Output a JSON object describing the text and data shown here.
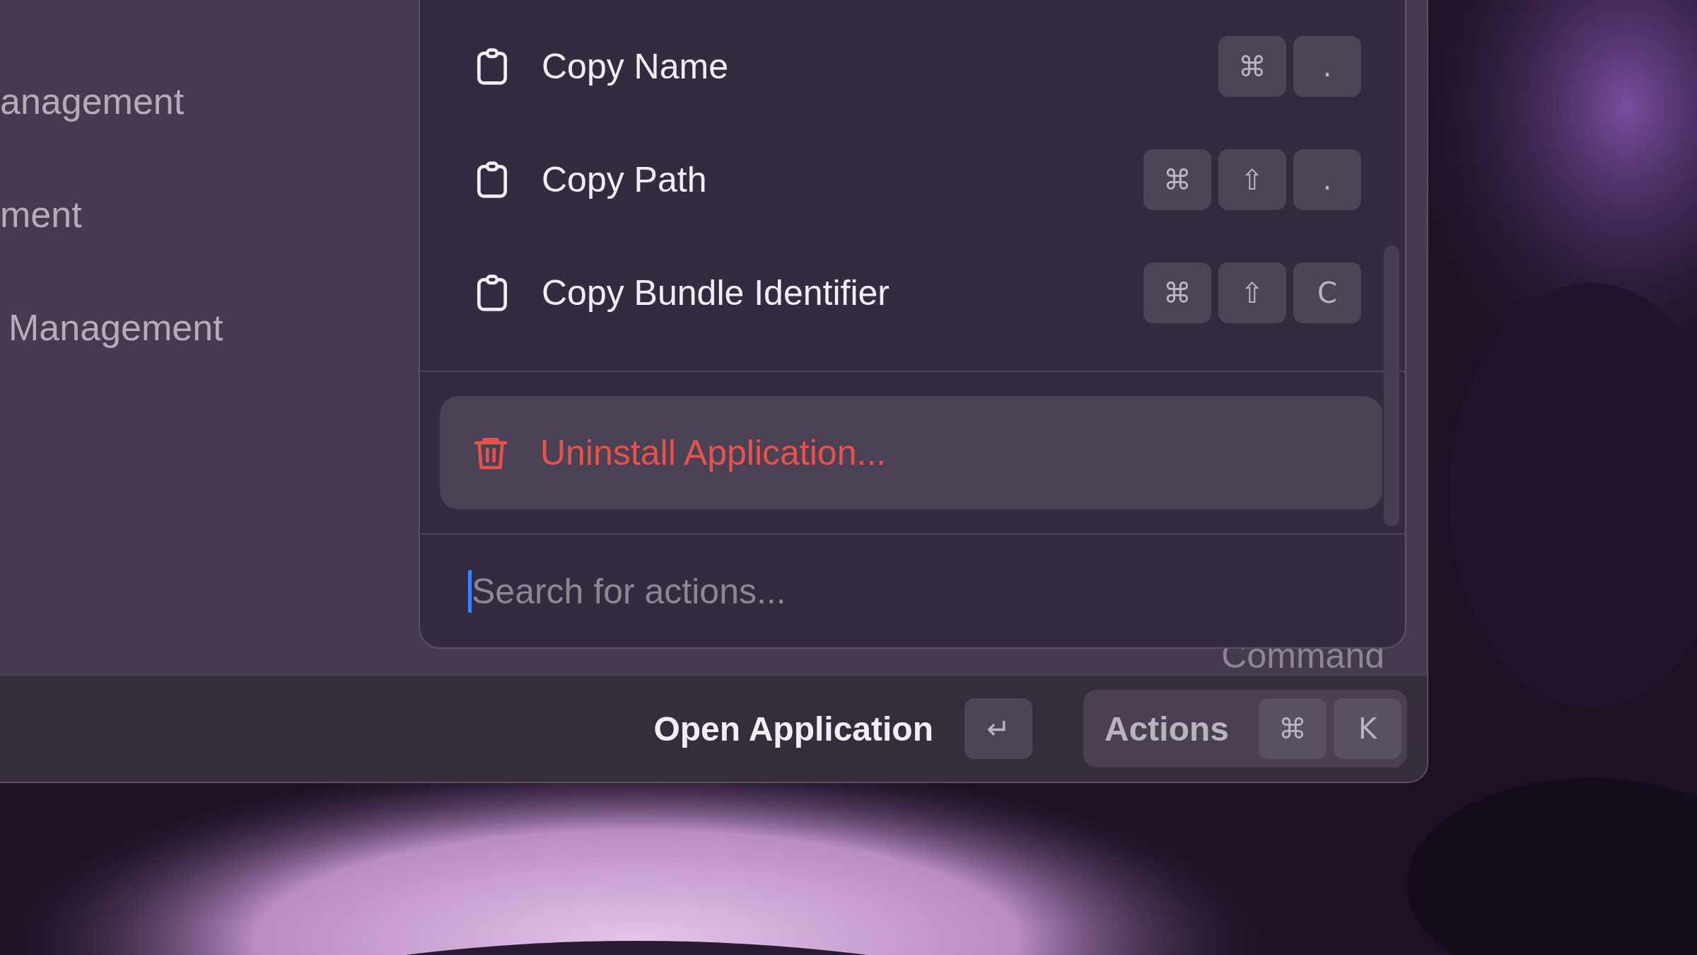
{
  "sidebar": {
    "items": [
      {
        "label": "anagement"
      },
      {
        "label": "ment"
      },
      {
        "label": "Management"
      }
    ]
  },
  "background_label": "Command",
  "action_panel": {
    "sections": [
      {
        "items": [
          {
            "kind": "copy",
            "label": "Copy Name",
            "selected": false,
            "shortcut": [
              "⌘",
              "."
            ]
          },
          {
            "kind": "copy",
            "label": "Copy Path",
            "selected": false,
            "shortcut": [
              "⌘",
              "⇧",
              "."
            ]
          },
          {
            "kind": "copy",
            "label": "Copy Bundle Identifier",
            "selected": false,
            "shortcut": [
              "⌘",
              "⇧",
              "C"
            ]
          }
        ]
      },
      {
        "items": [
          {
            "kind": "destructive",
            "label": "Uninstall Application...",
            "selected": true
          }
        ]
      }
    ],
    "search": {
      "placeholder": "Search for actions...",
      "focused": true
    }
  },
  "footer": {
    "primary_action": {
      "label": "Open Application",
      "shortcut": [
        "↵"
      ]
    },
    "actions_button": {
      "label": "Actions",
      "shortcut": [
        "⌘",
        "K"
      ]
    }
  }
}
